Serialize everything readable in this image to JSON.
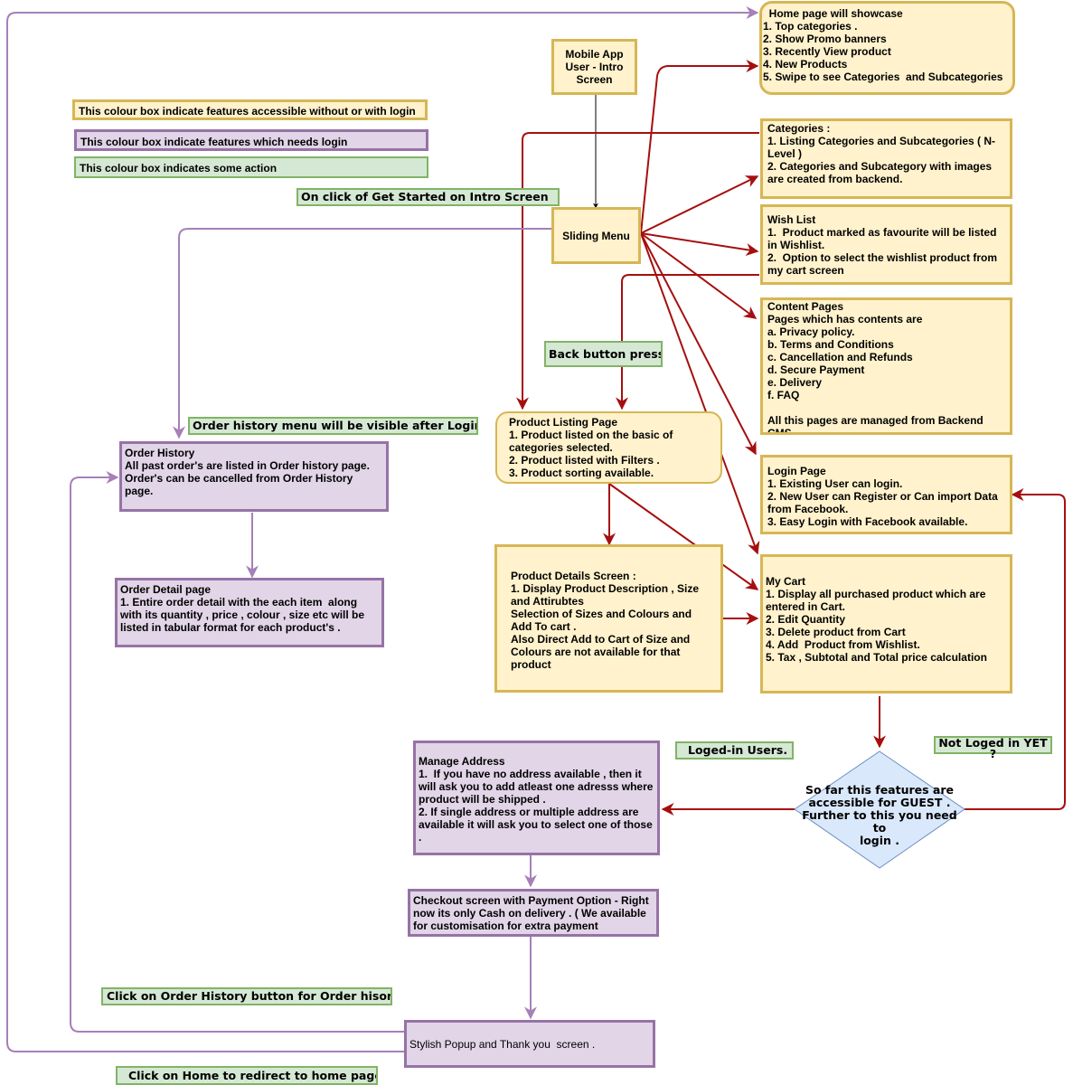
{
  "colors": {
    "feature_fill": "#fff2cc",
    "feature_border": "#d6b656",
    "login_fill": "#e1d5e7",
    "login_border": "#9673a6",
    "action_fill": "#d5e8d4",
    "action_border": "#82b366",
    "decision_fill": "#dae8fc",
    "decision_border": "#6c8ebf",
    "edge_red": "#a50f0f",
    "edge_purple": "#a680b8",
    "edge_black": "#000000"
  },
  "legend": {
    "without_or_with_login": "This colour box indicate features accessible without or with login",
    "needs_login": "This colour box indicate features which needs login",
    "action": "This colour box indicates some action"
  },
  "nodes": {
    "home_page": "  Home page will showcase\n1. Top categories .\n2. Show Promo banners\n3. Recently View product\n4. New Products\n5. Swipe to see Categories  and Subcategories",
    "intro_screen": "Mobile App User - Intro Screen",
    "sliding_menu": "Sliding Menu",
    "categories": "Categories :\n1. Listing Categories and Subcategories ( N-Level )\n2. Categories and Subcategory with images are created from backend.",
    "wish_list": "Wish List\n1.  Product marked as favourite will be listed in Wishlist.\n2.  Option to select the wishlist product from my cart screen",
    "content_pages": "Content Pages\nPages which has contents are\na. Privacy policy.\nb. Terms and Conditions\nc. Cancellation and Refunds\nd. Secure Payment\ne. Delivery\nf. FAQ\n\nAll this pages are managed from Backend CMS",
    "product_listing": "Product Listing Page\n1. Product listed on the basic of categories selected.\n2. Product listed with Filters .\n3. Product sorting available.",
    "login_page": "Login Page\n1. Existing User can login.\n2. New User can Register or Can import Data from Facebook.\n3. Easy Login with Facebook available.",
    "product_details": "Product Details Screen :\n1. Display Product Description , Size and Attirubtes\nSelection of Sizes and Colours and Add To cart .\nAlso Direct Add to Cart of Size and Colours are not available for that product",
    "my_cart": "My Cart\n1. Display all purchased product which are entered in Cart.\n2. Edit Quantity\n3. Delete product from Cart\n4. Add  Product from Wishlist.\n5. Tax , Subtotal and Total price calculation",
    "order_history": "Order History\nAll past order's are listed in Order history page.\nOrder's can be cancelled from Order History page.",
    "order_detail": "Order Detail page\n1. Entire order detail with the each item  along with its quantity , price , colour , size etc will be listed in tabular format for each product's .",
    "manage_address": "Manage Address\n1.  If you have no address available , then it will ask you to add atleast one adresss where product will be shipped .\n2. If single address or multiple address are available it will ask you to select one of those .",
    "checkout": "Checkout screen with Payment Option - Right now its only Cash on delivery . ( We available for customisation for extra payment gateway's)",
    "thank_you": "Stylish Popup and Thank you  screen .",
    "guest_decision": "So far this features are\naccessible for GUEST .\nFurther to this you need to\nlogin ."
  },
  "action_labels": {
    "get_started": "On click of Get Started on Intro Screen",
    "back_button": "Back button press",
    "order_history_visible": "Order history menu will be visible after Login",
    "logged_in_users": "Loged-in Users.",
    "not_logged_in": "Not Loged in YET\n?",
    "click_order_history": "Click on Order History button for  Order hisory",
    "click_home": "Click on Home to redirect to home page"
  }
}
